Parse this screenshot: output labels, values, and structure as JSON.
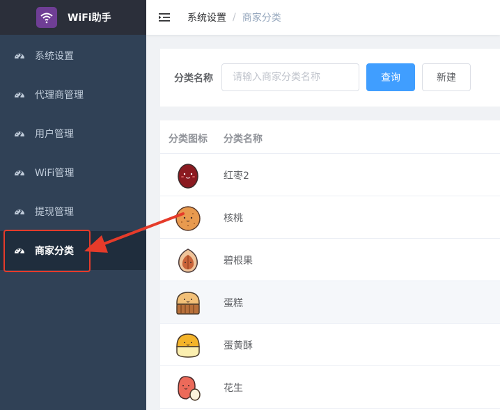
{
  "app": {
    "title": "WiFi助手"
  },
  "sidebar": {
    "items": [
      {
        "label": "系统设置",
        "icon": "dashboard-icon"
      },
      {
        "label": "代理商管理",
        "icon": "dashboard-icon"
      },
      {
        "label": "用户管理",
        "icon": "dashboard-icon"
      },
      {
        "label": "WiFi管理",
        "icon": "dashboard-icon"
      },
      {
        "label": "提现管理",
        "icon": "dashboard-icon"
      },
      {
        "label": "商家分类",
        "icon": "dashboard-icon",
        "active": true
      }
    ]
  },
  "breadcrumb": {
    "parent": "系统设置",
    "separator": "/",
    "current": "商家分类"
  },
  "search": {
    "label": "分类名称",
    "placeholder": "请输入商家分类名称",
    "value": "",
    "query_button": "查询",
    "new_button": "新建"
  },
  "table": {
    "columns": [
      "分类图标",
      "分类名称"
    ],
    "rows": [
      {
        "name": "红枣2",
        "icon": "red-date-icon"
      },
      {
        "name": "核桃",
        "icon": "walnut-icon"
      },
      {
        "name": "碧根果",
        "icon": "pecan-icon"
      },
      {
        "name": "蛋糕",
        "icon": "cake-icon"
      },
      {
        "name": "蛋黄酥",
        "icon": "egg-yolk-pastry-icon"
      },
      {
        "name": "花生",
        "icon": "peanut-icon"
      }
    ]
  },
  "colors": {
    "sidebar_bg": "#304156",
    "logo_bar_bg": "#2b2f3a",
    "primary": "#409eff",
    "annotation_red": "#e53b2a"
  }
}
